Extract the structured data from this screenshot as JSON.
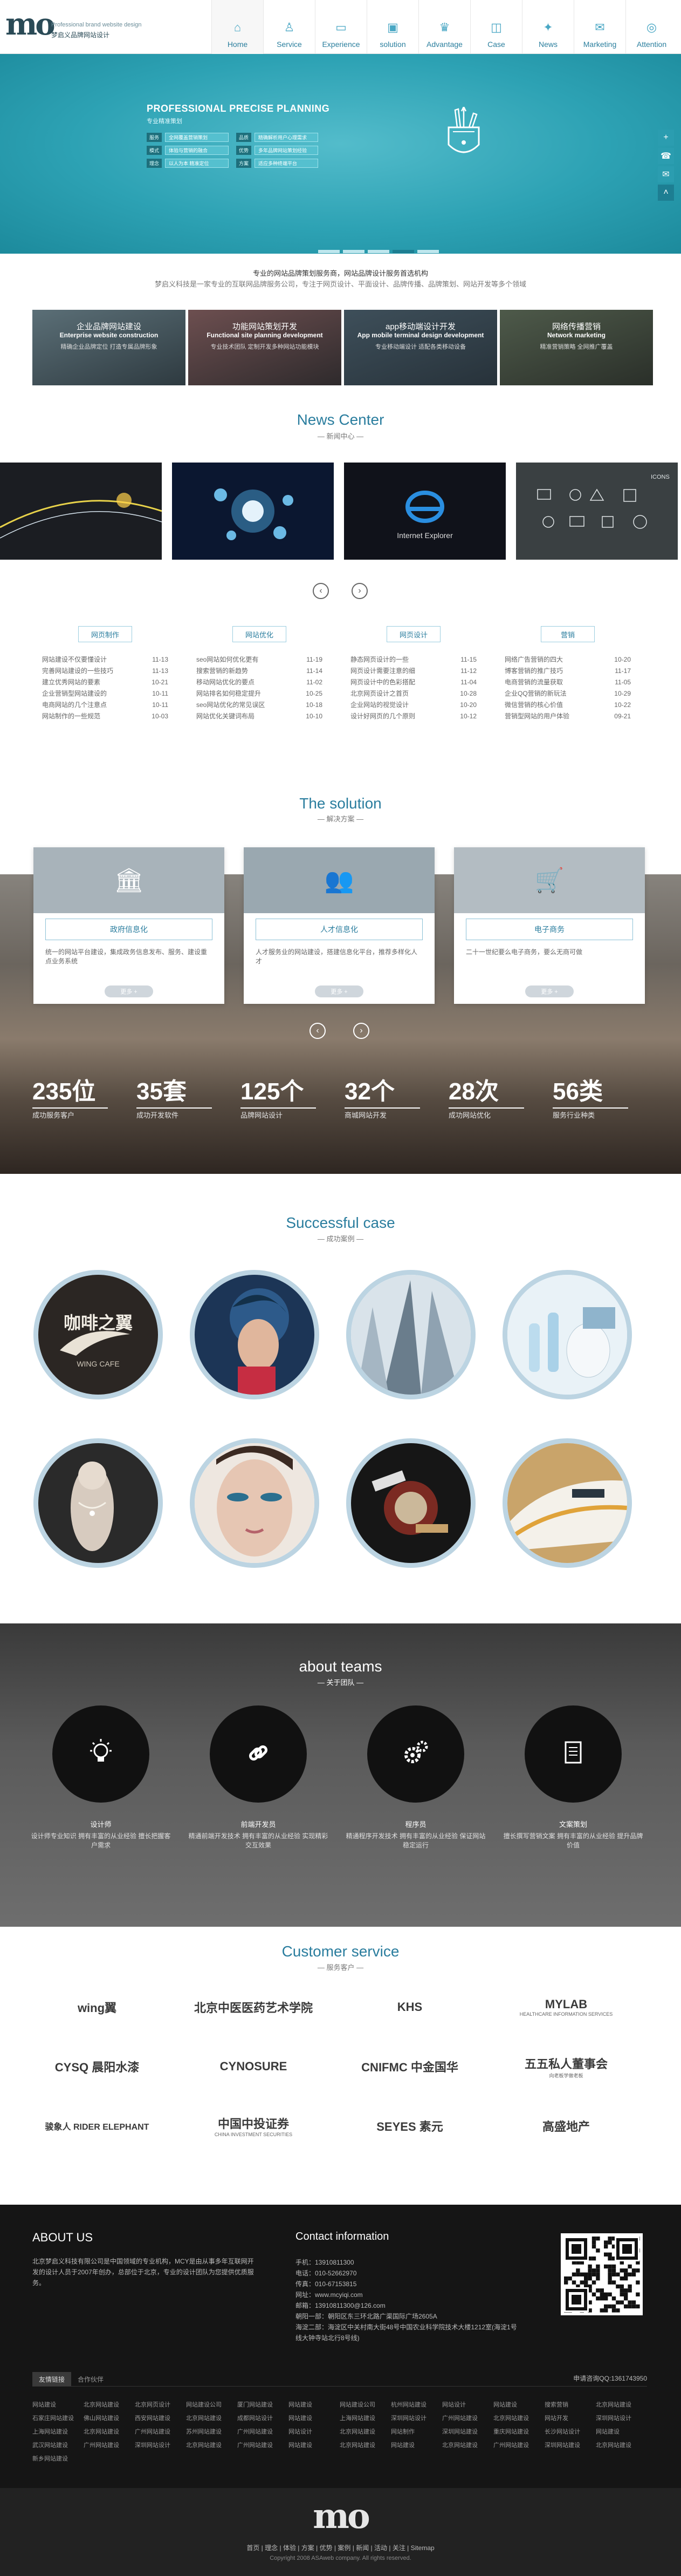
{
  "header": {
    "logo_tagline": "Professional brand website design",
    "logo_name": "梦启义品牌网站设计",
    "nav": [
      {
        "label": "Home",
        "icon": "home-icon"
      },
      {
        "label": "Service",
        "icon": "user-icon"
      },
      {
        "label": "Experience",
        "icon": "monitor-icon"
      },
      {
        "label": "solution",
        "icon": "briefcase-icon"
      },
      {
        "label": "Advantage",
        "icon": "advantage-icon"
      },
      {
        "label": "Case",
        "icon": "case-icon"
      },
      {
        "label": "News",
        "icon": "news-icon"
      },
      {
        "label": "Marketing",
        "icon": "marketing-icon"
      },
      {
        "label": "Attention",
        "icon": "attention-icon"
      }
    ]
  },
  "banner": {
    "title": "PROFESSIONAL PRECISE PLANNING",
    "subtitle": "专业精准策划",
    "rows": [
      [
        {
          "tag": "服务",
          "value": "全网覆盖营销策划"
        },
        {
          "tag": "品质",
          "value": "精确解析用户心理需求"
        }
      ],
      [
        {
          "tag": "模式",
          "value": "体验与营销的融合"
        },
        {
          "tag": "优势",
          "value": "多年品牌网站策划经验"
        }
      ],
      [
        {
          "tag": "理念",
          "value": "以人为本 精准定位"
        },
        {
          "tag": "方案",
          "value": "适应多种终端平台"
        }
      ]
    ],
    "slides": 5,
    "active_slide": 4
  },
  "intro": {
    "line1": "专业的网站品牌策划服务商，网站品牌设计服务首选机构",
    "line2": "梦启义科技是一家专业的互联网品牌服务公司，专注于网页设计、平面设计、品牌传播、品牌策划、网站开发等多个领域"
  },
  "services": [
    {
      "title": "企业品牌网站建设",
      "en": "Enterprise website construction",
      "desc": "精确企业品牌定位 打造专属品牌形象"
    },
    {
      "title": "功能网站策划开发",
      "en": "Functional site planning development",
      "desc": "专业技术团队 定制开发多种网站功能模块"
    },
    {
      "title": "app移动端设计开发",
      "en": "App mobile terminal design development",
      "desc": "专业移动端设计 适配各类移动设备"
    },
    {
      "title": "网络传播营销",
      "en": "Network marketing",
      "desc": "精准营销策略 全网推广覆盖"
    }
  ],
  "news": {
    "title": "News Center",
    "cn": "新闻中心",
    "images": [
      "news-image-1",
      "news-image-2",
      "news-image-3",
      "news-image-4"
    ],
    "categories": [
      {
        "label": "网页制作",
        "items": [
          {
            "t": "网站建设不仅要懂设计",
            "d": "11-13"
          },
          {
            "t": "完善网站建设的一些技巧",
            "d": "11-13"
          },
          {
            "t": "建立优秀网站的要素",
            "d": "10-21"
          },
          {
            "t": "企业营销型网站建设的",
            "d": "10-11"
          },
          {
            "t": "电商网站的几个注意点",
            "d": "10-11"
          },
          {
            "t": "网站制作的一些规范",
            "d": "10-03"
          }
        ]
      },
      {
        "label": "网站优化",
        "items": [
          {
            "t": "seo网站如何优化更有",
            "d": "11-19"
          },
          {
            "t": "搜索营销的新趋势",
            "d": "11-14"
          },
          {
            "t": "移动网站优化的要点",
            "d": "11-02"
          },
          {
            "t": "网站排名如何稳定提升",
            "d": "10-25"
          },
          {
            "t": "seo网站优化的常见误区",
            "d": "10-18"
          },
          {
            "t": "网站优化关键词布局",
            "d": "10-10"
          }
        ]
      },
      {
        "label": "网页设计",
        "items": [
          {
            "t": "静态网页设计的一些",
            "d": "11-15"
          },
          {
            "t": "网页设计需要注意的细",
            "d": "11-12"
          },
          {
            "t": "网页设计中的色彩搭配",
            "d": "11-04"
          },
          {
            "t": "北京网页设计之首页",
            "d": "10-28"
          },
          {
            "t": "企业网站的视觉设计",
            "d": "10-20"
          },
          {
            "t": "设计好网页的几个原则",
            "d": "10-12"
          }
        ]
      },
      {
        "label": "营销",
        "items": [
          {
            "t": "网络广告营销的四大",
            "d": "10-20"
          },
          {
            "t": "博客营销的推广技巧",
            "d": "11-17"
          },
          {
            "t": "电商营销的流量获取",
            "d": "11-05"
          },
          {
            "t": "企业QQ营销的新玩法",
            "d": "10-29"
          },
          {
            "t": "微信营销的核心价值",
            "d": "10-22"
          },
          {
            "t": "营销型网站的用户体验",
            "d": "09-21"
          }
        ]
      }
    ]
  },
  "solution": {
    "title": "The solution",
    "cn": "解决方案",
    "cards": [
      {
        "name": "政府信息化",
        "desc": "统一的网站平台建设，集成政务信息发布、服务、建设重点业务系统",
        "more": "更多 +",
        "icon": "government-icon"
      },
      {
        "name": "人才信息化",
        "desc": "人才服务业的网站建设，搭建信息化平台，推荐多样化人才",
        "more": "更多 +",
        "icon": "people-icon"
      },
      {
        "name": "电子商务",
        "desc": "二十一世纪要么电子商务，要么无商可做",
        "more": "更多 +",
        "icon": "cart-icon"
      }
    ],
    "stats": [
      {
        "n": "235位",
        "l": "成功服务客户"
      },
      {
        "n": "35套",
        "l": "成功开发软件"
      },
      {
        "n": "125个",
        "l": "品牌网站设计"
      },
      {
        "n": "32个",
        "l": "商城网站开发"
      },
      {
        "n": "28次",
        "l": "成功网站优化"
      },
      {
        "n": "56类",
        "l": "服务行业种类"
      }
    ]
  },
  "cases": {
    "title": "Successful case",
    "cn": "成功案例",
    "items": [
      "case-wing-cafe",
      "case-fashion-woman",
      "case-skyscraper",
      "case-laboratory",
      "case-jewelry",
      "case-makeup",
      "case-car-parts",
      "case-high-speed-train"
    ],
    "wing_text": "咖啡之翼",
    "wing_sub": "WING CAFE"
  },
  "team": {
    "title": "about teams",
    "cn": "关于团队",
    "members": [
      {
        "title": "设计师",
        "desc": "设计师专业知识 拥有丰富的从业经验 擅长把握客户需求",
        "icon": "lightbulb-icon"
      },
      {
        "title": "前端开发员",
        "desc": "精通前端开发技术 拥有丰富的从业经验 实现精彩交互效果",
        "icon": "link-icon"
      },
      {
        "title": "程序员",
        "desc": "精通程序开发技术 拥有丰富的从业经验 保证网站稳定运行",
        "icon": "gears-icon"
      },
      {
        "title": "文案策划",
        "desc": "擅长撰写营销文案 拥有丰富的从业经验 提升品牌价值",
        "icon": "document-icon"
      }
    ]
  },
  "customers": {
    "title": "Customer service",
    "cn": "服务客户",
    "logos": [
      {
        "text": "wing翼"
      },
      {
        "text": "北京中医医药艺术学院"
      },
      {
        "text": "KHS"
      },
      {
        "text": "MYLAB",
        "sub": "HEALTHCARE INFORMATION SERVICES"
      },
      {
        "text": "CYSQ 晨阳水漆"
      },
      {
        "text": "CYNOSURE"
      },
      {
        "text": "CNIFMC 中金国华"
      },
      {
        "text": "五五私人董事会",
        "sub": "向老板学做老板"
      },
      {
        "text": "骏象人 RIDER ELEPHANT"
      },
      {
        "text": "中国中投证券",
        "sub": "CHINA INVESTMENT SECURITIES"
      },
      {
        "text": "SEYES 素元"
      },
      {
        "text": "高盛地产"
      }
    ]
  },
  "footer": {
    "about_title": "ABOUT US",
    "about_text": "北京梦启义科技有限公司是中国领域的专业机构，MCY是由从事多年互联网开发的设计人员于2007年创办，总部位于北京，专业的设计团队为您提供优质服务。",
    "contact_title": "Contact information",
    "contact": [
      "手机：13910811300",
      "电话：010-52662970",
      "传真：010-67153815",
      "网址：www.mcyiqi.com",
      "邮箱：13910811300@126.com",
      "朝阳一部：朝阳区东三环北路广渠国际广场2605A",
      "海淀二部：海淀区中关村南大街48号中国农业科学院技术大楼1212室(海淀1号线大钟寺站北行8号线)"
    ],
    "consult": "申请咨询QQ:1361743950",
    "tabs": [
      "友情链接",
      "合作伙伴"
    ],
    "links": [
      "网站建设",
      "北京网站建设",
      "北京网页设计",
      "网站建设公司",
      "厦门网站建设",
      "网站建设",
      "网站建设公司",
      "杭州网站建设",
      "网站设计",
      "网站建设",
      "搜索营销",
      "北京网站建设",
      "石家庄网站建设",
      "佛山网站建设",
      "西安网站建设",
      "北京网站建设",
      "成都网站设计",
      "网站建设",
      "上海网站建设",
      "深圳网站设计",
      "广州网站建设",
      "北京网站建设",
      "网站开发",
      "深圳网站设计",
      "上海网站建设",
      "北京网站建设",
      "广州网站建设",
      "苏州网站建设",
      "广州网站建设",
      "网站设计",
      "北京网站建设",
      "网站制作",
      "深圳网站建设",
      "重庆网站建设",
      "长沙网站设计",
      "网站建设",
      "武汉网站建设",
      "广州网站建设",
      "深圳网站设计",
      "北京网站建设",
      "广州网站建设",
      "网站建设",
      "北京网站建设",
      "网站建设",
      "北京网站建设",
      "广州网站建设",
      "深圳网站建设",
      "北京网站建设",
      "新乡网站建设"
    ],
    "bottom_links": [
      "首页",
      "理念",
      "体验",
      "方案",
      "优势",
      "案例",
      "新闻",
      "活动",
      "关注",
      "Sitemap"
    ],
    "copyright": "Copyright 2008 ASAweb company. All rights reserved.",
    "bottom_logo": "mo"
  }
}
